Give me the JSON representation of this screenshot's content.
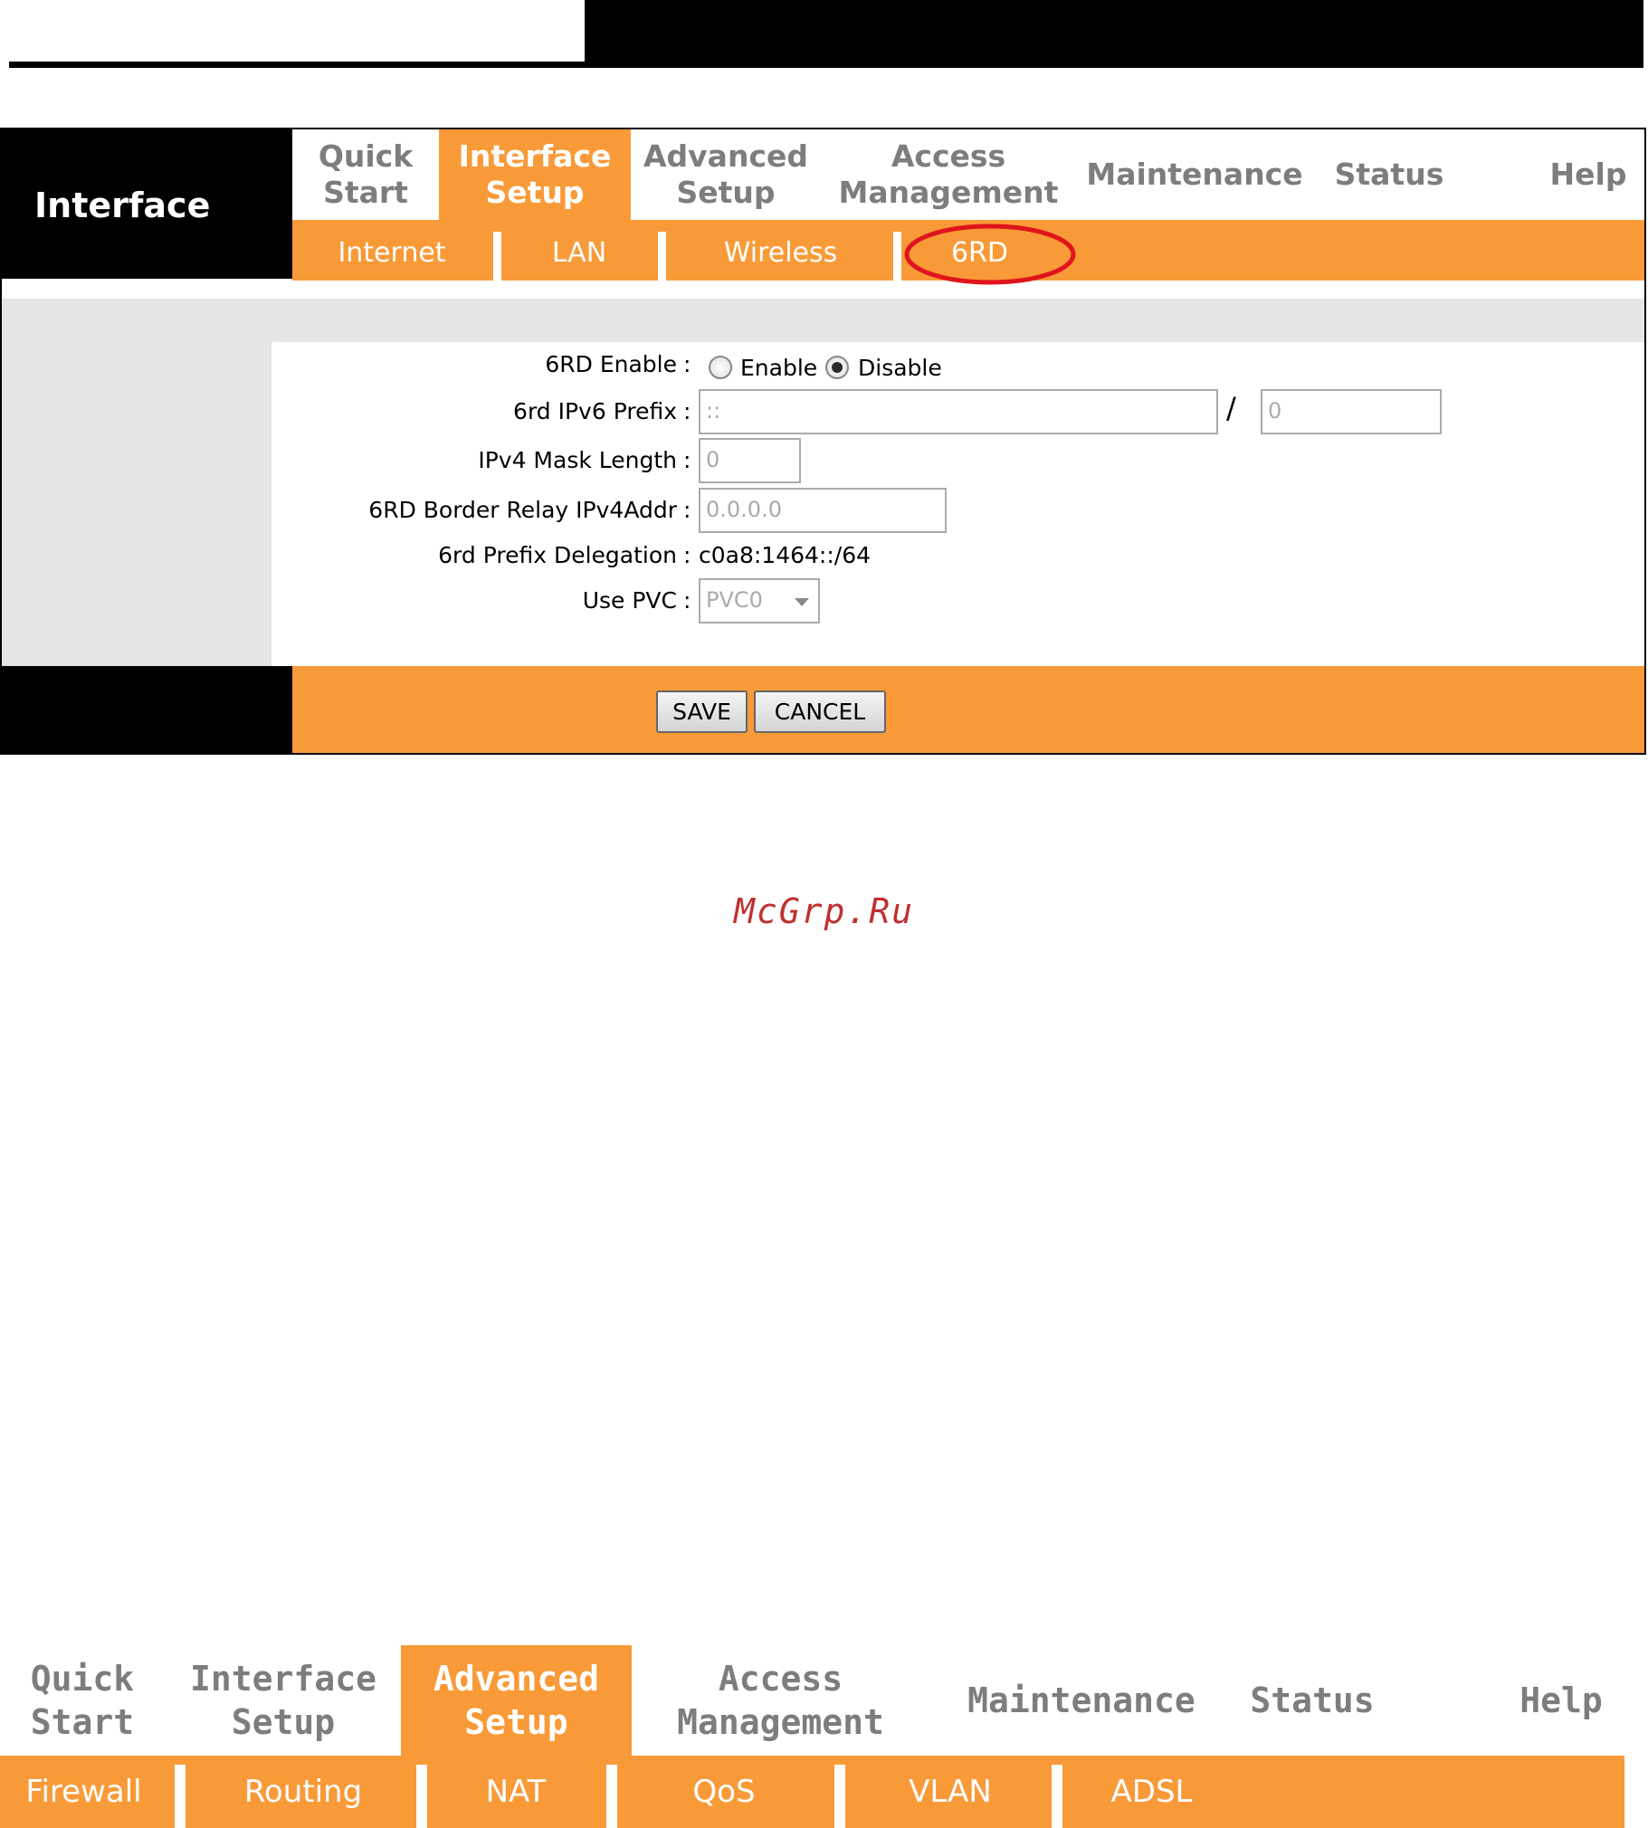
{
  "header": {},
  "frame1": {
    "section_title": "Interface",
    "top_nav": [
      {
        "label": "Quick\nStart"
      },
      {
        "label": "Interface\nSetup",
        "active": true
      },
      {
        "label": "Advanced\nSetup"
      },
      {
        "label": "Access\nManagement"
      },
      {
        "label": "Maintenance"
      },
      {
        "label": "Status"
      },
      {
        "label": "Help"
      }
    ],
    "sub_nav": [
      {
        "label": "Internet"
      },
      {
        "label": "LAN"
      },
      {
        "label": "Wireless"
      },
      {
        "label": "6RD",
        "highlighted": true
      }
    ],
    "form": {
      "enable_label": "6RD Enable",
      "enable_option": "Enable",
      "disable_option": "Disable",
      "selected": "Disable",
      "prefix_label": "6rd IPv6 Prefix",
      "prefix_value": "::",
      "prefix_sep": "/",
      "prefix_len_value": "0",
      "mask_label": "IPv4 Mask Length",
      "mask_value": "0",
      "relay_label": "6RD Border Relay IPv4Addr",
      "relay_value": "0.0.0.0",
      "delegation_label": "6rd Prefix Delegation",
      "delegation_value": "c0a8:1464::/64",
      "pvc_label": "Use PVC",
      "pvc_value": "PVC0",
      "colon": ":"
    },
    "buttons": {
      "save": "SAVE",
      "cancel": "CANCEL"
    }
  },
  "watermark": "McGrp.Ru",
  "frame2": {
    "top_nav": [
      {
        "label": "Quick\nStart"
      },
      {
        "label": "Interface\nSetup"
      },
      {
        "label": "Advanced\nSetup",
        "active": true
      },
      {
        "label": "Access\nManagement"
      },
      {
        "label": "Maintenance"
      },
      {
        "label": "Status"
      },
      {
        "label": "Help"
      }
    ],
    "sub_nav": [
      {
        "label": "Firewall"
      },
      {
        "label": "Routing"
      },
      {
        "label": "NAT"
      },
      {
        "label": "QoS"
      },
      {
        "label": "VLAN"
      },
      {
        "label": "ADSL"
      }
    ]
  },
  "colors": {
    "orange": "#f99a38",
    "highlight_circle": "#e0141c",
    "nav_gray": "#7d7d7d",
    "watermark": "#c0302f"
  }
}
